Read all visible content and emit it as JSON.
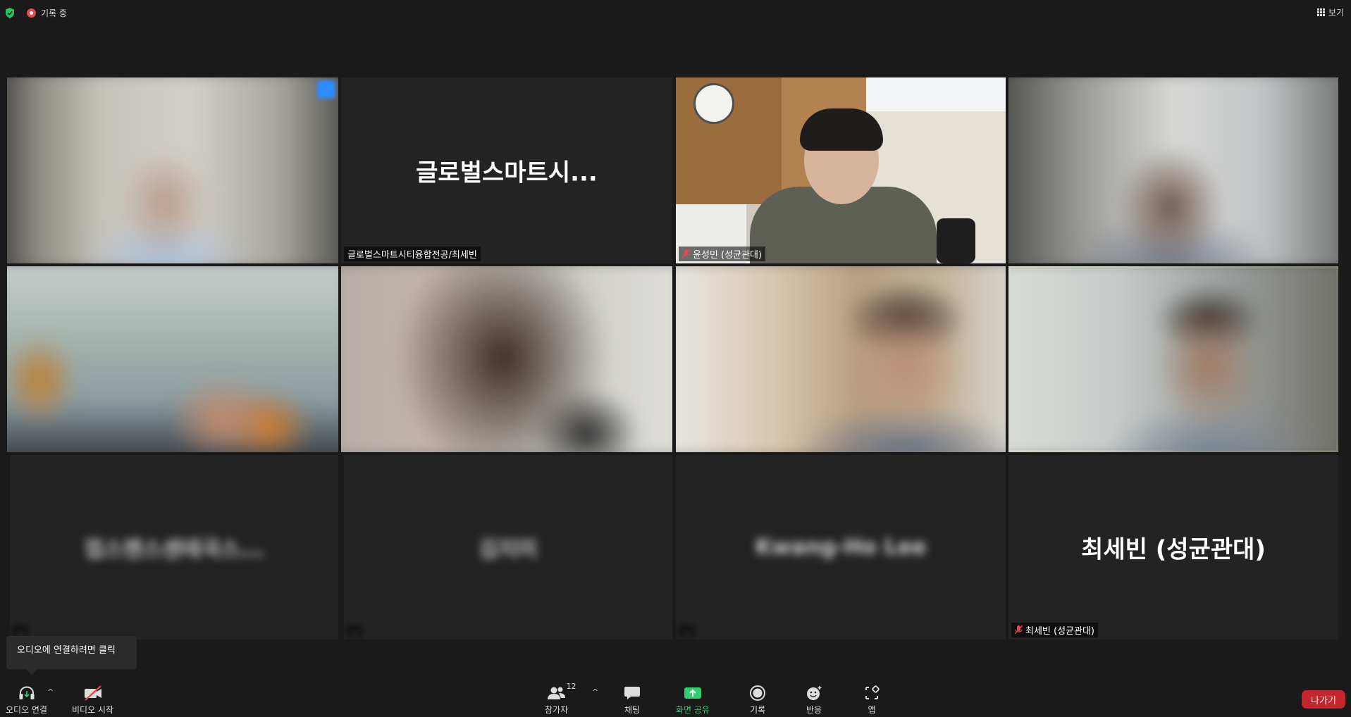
{
  "topbar": {
    "recording_label": "기록 중",
    "view_label": "보기"
  },
  "tiles": [
    {
      "center_name": "",
      "nametag": ""
    },
    {
      "center_name": "글로벌스마트시...",
      "nametag": "글로벌스마트시티융합전공/최세빈"
    },
    {
      "center_name": "",
      "nametag": "윤성민 (성균관대)"
    },
    {
      "center_name": "",
      "nametag": ""
    },
    {
      "center_name": "",
      "nametag": ""
    },
    {
      "center_name": "",
      "nametag": ""
    },
    {
      "center_name": "",
      "nametag": ""
    },
    {
      "center_name": "",
      "nametag": ""
    },
    {
      "center_name": "접스맨스센테국스...",
      "nametag": "..."
    },
    {
      "center_name": "김지미",
      "nametag": "..."
    },
    {
      "center_name": "Kwang-Ho Lee",
      "nametag": "..."
    },
    {
      "center_name": "최세빈 (성균관대)",
      "nametag": "최세빈 (성균관대)"
    }
  ],
  "tooltip": {
    "text": "오디오에 연결하려면 클릭"
  },
  "toolbar": {
    "audio_label": "오디오 연결",
    "video_label": "비디오 시작",
    "participants_label": "참가자",
    "participants_count": "12",
    "chat_label": "채팅",
    "share_label": "화면 공유",
    "record_label": "기록",
    "reactions_label": "반응",
    "apps_label": "앱",
    "leave_label": "나가기"
  },
  "colors": {
    "share_green": "#2ecf6e",
    "leave_red": "#c4262d",
    "recording_red": "#e5484d",
    "shield_green": "#22c55e",
    "active_speaker": "#9ac25c"
  }
}
